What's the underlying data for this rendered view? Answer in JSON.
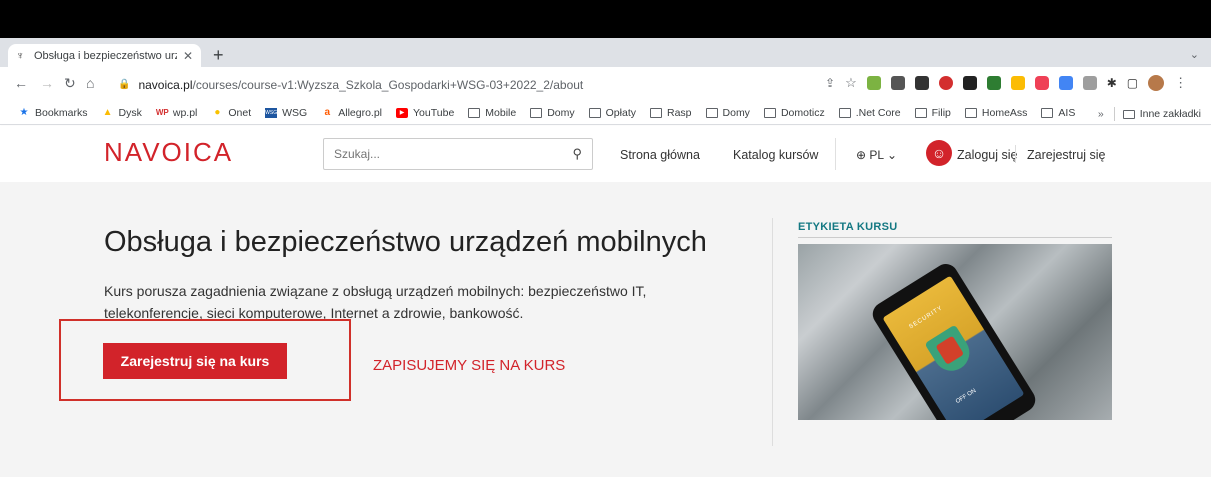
{
  "browser": {
    "tab_title": "Obsługa i bezpieczeństwo urządzeń mobilnych",
    "tab_title_shown": "Obsługa i bezpieczeństwo urzą",
    "tab_favicon": "navoica-icon",
    "new_tab_symbol": "+",
    "url_host": "navoica.pl",
    "url_path": "/courses/course-v1:Wyzsza_Szkola_Gospodarki+WSG-03+2022_2/about"
  },
  "bookmarks": {
    "items": [
      {
        "label": "Bookmarks",
        "icon": "star-icon"
      },
      {
        "label": "Dysk",
        "icon": "drive-icon"
      },
      {
        "label": "wp.pl",
        "icon": "wp-icon"
      },
      {
        "label": "Onet",
        "icon": "onet-icon"
      },
      {
        "label": "WSG",
        "icon": "wsg-icon"
      },
      {
        "label": "Allegro.pl",
        "icon": "allegro-icon"
      },
      {
        "label": "YouTube",
        "icon": "youtube-icon"
      },
      {
        "label": "Mobile",
        "icon": "folder-icon"
      },
      {
        "label": "Domy",
        "icon": "folder-icon"
      },
      {
        "label": "Opłaty",
        "icon": "folder-icon"
      },
      {
        "label": "Rasp",
        "icon": "folder-icon"
      },
      {
        "label": "Domy",
        "icon": "folder-icon"
      },
      {
        "label": "Domoticz",
        "icon": "folder-icon"
      },
      {
        "label": ".Net Core",
        "icon": "folder-icon"
      },
      {
        "label": "Filip",
        "icon": "folder-icon"
      },
      {
        "label": "HomeAss",
        "icon": "folder-icon"
      },
      {
        "label": "AIS",
        "icon": "folder-icon"
      }
    ],
    "overflow": "»",
    "other": "Inne zakładki"
  },
  "site": {
    "logo": "NAVOICA",
    "search_placeholder": "Szukaj...",
    "nav_home": "Strona główna",
    "nav_catalog": "Katalog kursów",
    "lang": "PL",
    "login": "Zaloguj się",
    "register": "Zarejestruj się"
  },
  "course": {
    "title": "Obsługa i bezpieczeństwo urządzeń mobilnych",
    "description": "Kurs porusza zagadnienia związane z obsługą urządzeń mobilnych: bezpieczeństwo IT, telekonferencje, sieci komputerowe, Internet a zdrowie, bankowość.",
    "enroll_button": "Zarejestruj się na kurs",
    "annotation": "ZAPISUJEMY SIĘ NA KURS",
    "label": "ETYKIETA KURSU",
    "image_text_security": "SECURITY",
    "image_text_toggle": "OFF ON"
  },
  "colors": {
    "accent": "#d2232a",
    "label": "#137882",
    "background": "#f4f4f4"
  }
}
